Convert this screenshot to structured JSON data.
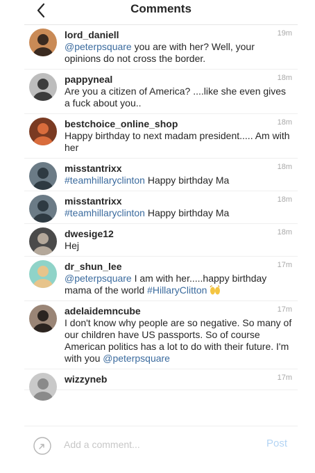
{
  "header": {
    "title": "Comments",
    "back_icon": "chevron-left-icon"
  },
  "comments": [
    {
      "username": "lord_daniell",
      "time": "19m",
      "segments": [
        {
          "text": "@peterpsquare",
          "mention": true
        },
        {
          "text": " you are with her? Well, your opinions do not cross the border.",
          "mention": false
        }
      ]
    },
    {
      "username": "pappyneal",
      "time": "18m",
      "segments": [
        {
          "text": "Are you a citizen of America? ....like she even gives a fuck about you..",
          "mention": false
        }
      ]
    },
    {
      "username": "bestchoice_online_shop",
      "time": "18m",
      "segments": [
        {
          "text": "Happy birthday to next madam  president..... Am with her",
          "mention": false
        }
      ]
    },
    {
      "username": "misstantrixx",
      "time": "18m",
      "segments": [
        {
          "text": "#teamhillaryclinton",
          "mention": true
        },
        {
          "text": " Happy birthday Ma",
          "mention": false
        }
      ]
    },
    {
      "username": "misstantrixx",
      "time": "18m",
      "segments": [
        {
          "text": "#teamhillaryclinton",
          "mention": true
        },
        {
          "text": " Happy birthday Ma",
          "mention": false
        }
      ]
    },
    {
      "username": "dwesige12",
      "time": "18m",
      "segments": [
        {
          "text": "Hej",
          "mention": false
        }
      ]
    },
    {
      "username": "dr_shun_lee",
      "time": "17m",
      "segments": [
        {
          "text": "@peterpsquare",
          "mention": true
        },
        {
          "text": " I am with her.....happy birthday mama of the world ",
          "mention": false
        },
        {
          "text": "#HillaryClitton",
          "mention": true
        }
      ],
      "emoji": "raised-hands-emoji"
    },
    {
      "username": "adelaidemncube",
      "time": "17m",
      "segments": [
        {
          "text": "I don't know why people are so negative. So many of our children have US passports. So of course American politics has a lot to do with their future. I'm with you ",
          "mention": false
        },
        {
          "text": "@peterpsquare",
          "mention": true
        }
      ]
    },
    {
      "username": "wizzyneb",
      "time": "17m",
      "segments": []
    }
  ],
  "composer": {
    "placeholder": "Add a comment...",
    "post_label": "Post",
    "camera_icon": "camera-icon"
  },
  "colors": {
    "mention": "#3b6b9e",
    "timestamp": "#a8a8a8",
    "post_disabled": "#b3d4f4",
    "placeholder": "#c7c7c7"
  }
}
